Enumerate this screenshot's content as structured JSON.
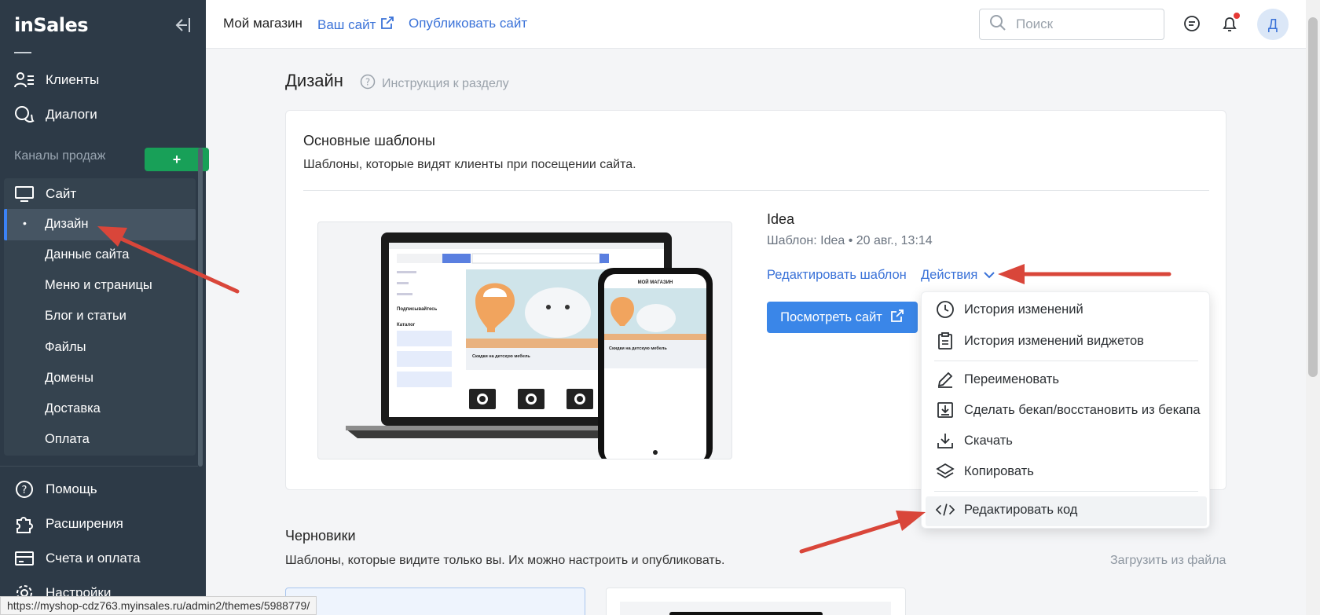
{
  "sidebar": {
    "logo": "inSales",
    "items_top": [
      {
        "label": "Клиенты",
        "icon": "clients-icon"
      },
      {
        "label": "Диалоги",
        "icon": "chat-icon"
      }
    ],
    "channels_label": "Каналы продаж",
    "channels_add": "+",
    "site": {
      "label": "Сайт",
      "icon": "monitor-icon"
    },
    "site_subitems": [
      "Дизайн",
      "Данные сайта",
      "Меню и страницы",
      "Блог и статьи",
      "Файлы",
      "Домены",
      "Доставка",
      "Оплата"
    ],
    "active_subitem_bullet": "•",
    "items_bottom": [
      {
        "label": "Помощь",
        "icon": "help-icon"
      },
      {
        "label": "Расширения",
        "icon": "puzzle-icon"
      },
      {
        "label": "Счета и оплата",
        "icon": "card-icon"
      },
      {
        "label": "Настройки",
        "icon": "gear-icon"
      }
    ]
  },
  "header": {
    "store": "Мой магазин",
    "your_site": "Ваш сайт",
    "publish": "Опубликовать сайт",
    "search_placeholder": "Поиск",
    "avatar": "Д"
  },
  "page": {
    "title": "Дизайн",
    "help": "Инструкция к разделу"
  },
  "main_templates": {
    "title": "Основные шаблоны",
    "subtitle": "Шаблоны, которые видят клиенты при посещении сайта.",
    "theme_name": "Idea",
    "theme_meta": "Шаблон: Idea • 20 авг., 13:14",
    "edit_template": "Редактировать шаблон",
    "actions": "Действия",
    "view_site": "Посмотреть сайт",
    "preview": {
      "store_title": "МОЙ МАГАЗИН",
      "subscribe": "Подписывайтесь",
      "catalog": "Каталог",
      "promo": "Скидки на детскую мебель",
      "phone_promo": "Скидки на детскую мебель"
    }
  },
  "actions_menu": {
    "items": [
      {
        "label": "История изменений",
        "icon": "clock-icon"
      },
      {
        "label": "История изменений виджетов",
        "icon": "clipboard-icon"
      },
      {
        "label": "Переименовать",
        "icon": "pencil-icon"
      },
      {
        "label": "Сделать бекап/восстановить из бекапа",
        "icon": "backup-icon"
      },
      {
        "label": "Скачать",
        "icon": "download-icon"
      },
      {
        "label": "Копировать",
        "icon": "layers-icon"
      },
      {
        "label": "Редактировать код",
        "icon": "code-icon"
      }
    ]
  },
  "drafts": {
    "title": "Черновики",
    "subtitle": "Шаблоны, которые видите только вы. Их можно настроить и опубликовать.",
    "upload": "Загрузить из файла"
  },
  "status_url": "https://myshop-cdz763.myinsales.ru/admin2/themes/5988779/",
  "colors": {
    "sidebar_bg": "#2d3a47",
    "accent_blue": "#3a86e8",
    "link_blue": "#3a72d8",
    "add_green": "#18a058",
    "annotation_arrow": "#d9463a"
  }
}
